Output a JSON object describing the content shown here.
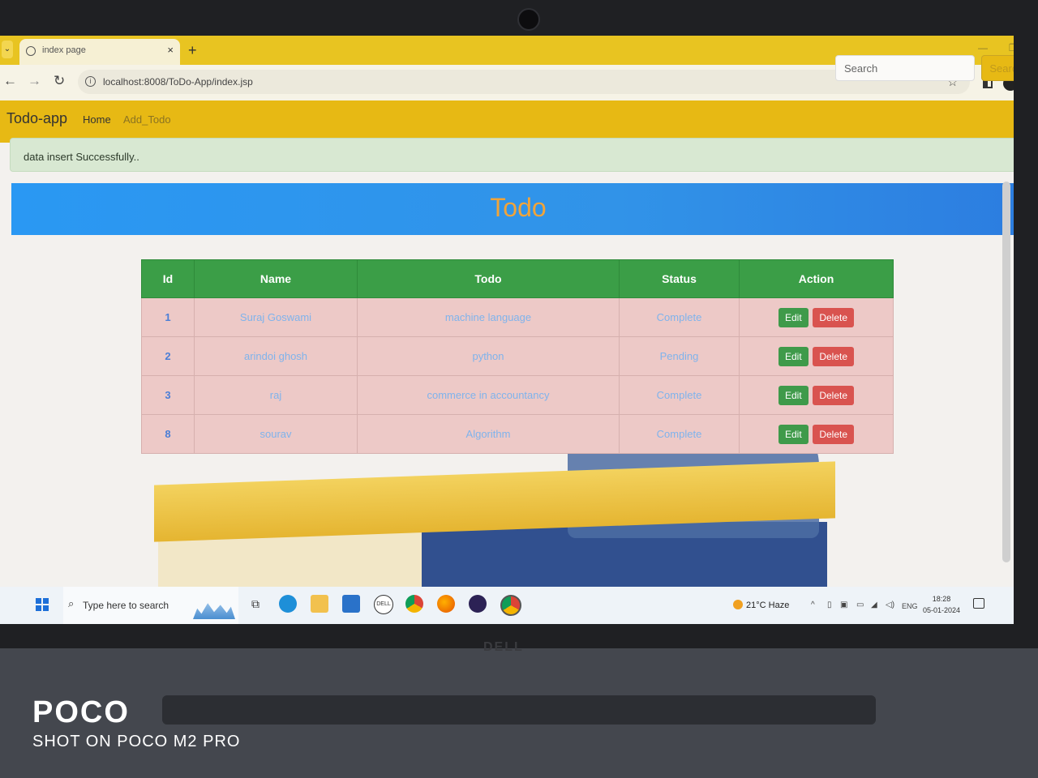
{
  "browser": {
    "tab_title": "index page",
    "new_tab": "+",
    "url": "localhost:8008/ToDo-App/index.jsp"
  },
  "navbar": {
    "brand": "Todo-app",
    "links": [
      "Home",
      "Add_Todo"
    ],
    "search_placeholder": "Search",
    "search_button": "Search"
  },
  "alert": {
    "message": "data insert Successfully.."
  },
  "page": {
    "title": "Todo"
  },
  "table": {
    "headers": [
      "Id",
      "Name",
      "Todo",
      "Status",
      "Action"
    ],
    "rows": [
      {
        "id": "1",
        "name": "Suraj Goswami",
        "todo": "machine language",
        "status": "Complete"
      },
      {
        "id": "2",
        "name": "arindoi ghosh",
        "todo": "python",
        "status": "Pending"
      },
      {
        "id": "3",
        "name": "raj",
        "todo": "commerce in accountancy",
        "status": "Complete"
      },
      {
        "id": "8",
        "name": "sourav",
        "todo": "Algorithm",
        "status": "Complete"
      }
    ],
    "edit_label": "Edit",
    "delete_label": "Delete"
  },
  "taskbar": {
    "search_text": "Type here to search",
    "weather": "21°C  Haze",
    "lang": "ENG",
    "time": "18:28",
    "date": "05-01-2024"
  },
  "watermark": {
    "brand": "POCO",
    "subtitle": "SHOT ON POCO M2 PRO"
  },
  "colors": {
    "navbar": "#e7b914",
    "header_band": "#2a98f3",
    "title_text": "#f0a43a",
    "table_header": "#3b9e47",
    "row_bg": "#edc9c7",
    "edit_button": "#3f9a4a",
    "delete_button": "#d9534f"
  },
  "icons": [
    "globe-icon",
    "back-icon",
    "forward-icon",
    "reload-icon",
    "info-icon",
    "star-icon",
    "side-panel-icon",
    "profile-icon",
    "windows-start-icon",
    "search-icon",
    "task-view-icon",
    "edge-icon",
    "file-explorer-icon",
    "mail-icon",
    "dell-icon",
    "chrome-icon",
    "firefox-icon",
    "eclipse-icon",
    "chrome-dev-icon",
    "notification-icon"
  ]
}
